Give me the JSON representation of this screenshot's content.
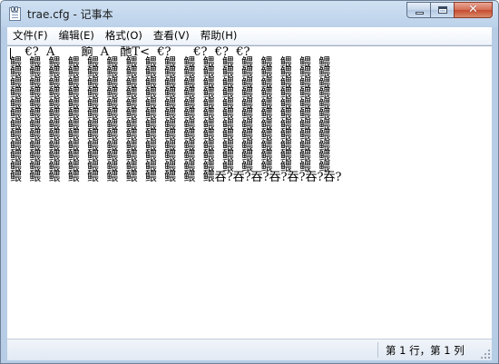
{
  "window": {
    "title": "trae.cfg - 记事本",
    "close_glyph": "✕"
  },
  "menu": {
    "items": [
      {
        "id": "file",
        "label": "文件(F)"
      },
      {
        "id": "edit",
        "label": "编辑(E)"
      },
      {
        "id": "format",
        "label": "格式(O)"
      },
      {
        "id": "view",
        "label": "查看(V)"
      },
      {
        "id": "help",
        "label": "帮助(H)"
      }
    ]
  },
  "editor": {
    "content": "    €?  A       餉  A   酏T<  €?      €?  €?  €?\n鳂  鳂  鳂  鳂  鳂  鳂  鳂  鳂  鳂  鳂  鳂  鳂  鳂  鳂  鳂  鳂  鳂\n鳂  鳂  鳂  鳂  鳂  鳂  鳂  鳂  鳂  鳂  鳂  鳂  鳂  鳂  鳂  鳂  鳂\n鳂  鳂  鳂  鳂  鳂  鳂  鳂  鳂  鳂  鳂  鳂  鳂  鳂  鳂  鳂  鳂  鳂\n鳂  鳂  鳂  鳂  鳂  鳂  鳂  鳂  鳂  鳂  鳂  鳂  鳂  鳂  鳂  鳂  鳂\n鳂  鳂  鳂  鳂  鳂  鳂  鳂  鳂  鳂  鳂  鳂  鳂  鳂  鳂  鳂  鳂  鳂\n鳂  鳂  鳂  鳂  鳂  鳂  鳂  鳂  鳂  鳂  鳂  鳂  鳂  鳂  鳂  鳂  鳂\n鳂  鳂  鳂  鳂  鳂  鳂  鳂  鳂  鳂  鳂  鳂  鳂  鳂  鳂  鳂  鳂  鳂\n鳂  鳂  鳂  鳂  鳂  鳂  鳂  鳂  鳂  鳂  鳂  鳂  鳂  鳂  鳂  鳂  鳂\n鳂  鳂  鳂  鳂  鳂  鳂  鳂  鳂  鳂  鳂  鳂  鳂  鳂  鳂  鳂  鳂  鳂\n鳂  鳂  鳂  鳂  鳂  鳂  鳂  鳂  鳂  鳂  鳂  鳂  鳂  鳂  鳂  鳂  鳂\n鳂  鳂  鳂  鳂  鳂  鳂  鳂  鳂  鳂  鳂  鳂  鳂  鳂  鳂  鳂  鳂  鳂\n鳂  鳂  鳂  鳂  鳂  鳂  鳂  鳂  鳂  鳂  鳂吞?吞?吞?吞?吞?吞?吞?"
  },
  "status": {
    "position": "第 1 行，第 1 列"
  },
  "icons": {
    "app": "notepad-icon",
    "minimize": "minimize-icon",
    "maximize": "maximize-icon",
    "close": "close-icon",
    "grip": "size-grip-icon"
  },
  "colors": {
    "titlebar": "#bcd2ea",
    "close_button": "#c44a30",
    "editor_background": "#ffffff"
  }
}
